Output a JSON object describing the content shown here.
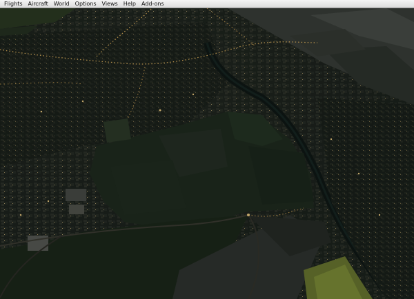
{
  "menubar": {
    "items": [
      {
        "label": "Flights"
      },
      {
        "label": "Aircraft"
      },
      {
        "label": "World"
      },
      {
        "label": "Options"
      },
      {
        "label": "Views"
      },
      {
        "label": "Help"
      },
      {
        "label": "Add-ons"
      }
    ]
  },
  "scene": {
    "description_colors": {
      "sky": "#6e88a6",
      "city": "#1f2620",
      "fields": "#1c2a1c",
      "river": "#0f1a18",
      "streetlights": "#ffd98a",
      "lit_field": "#8a9a3c"
    }
  }
}
